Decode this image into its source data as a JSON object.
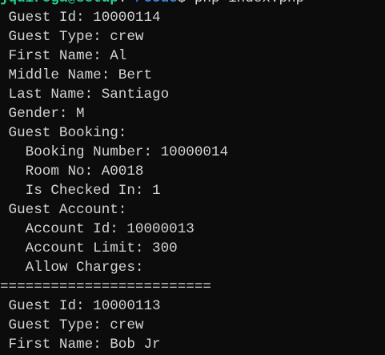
{
  "prompt": {
    "user_host": "jquiroga@setup",
    "separator": ":",
    "path": "~/code",
    "symbol": "$ ",
    "command": "php index.php"
  },
  "output_lines": [
    " Guest Id: 10000114",
    " Guest Type: crew",
    " First Name: Al",
    " Middle Name: Bert",
    " Last Name: Santiago",
    " Gender: M",
    " Guest Booking:",
    "   Booking Number: 10000014",
    "   Room No: A0018",
    "   Is Checked In: 1",
    " Guest Account:",
    "   Account Id: 10000013",
    "   Account Limit: 300",
    "   Allow Charges:",
    "=========================",
    " Guest Id: 10000113",
    " Guest Type: crew",
    " First Name: Bob Jr"
  ],
  "colors": {
    "background": "#0c0c0c",
    "text": "#d4d4d4",
    "prompt_user": "#23d18b",
    "prompt_path": "#3b8eea"
  }
}
